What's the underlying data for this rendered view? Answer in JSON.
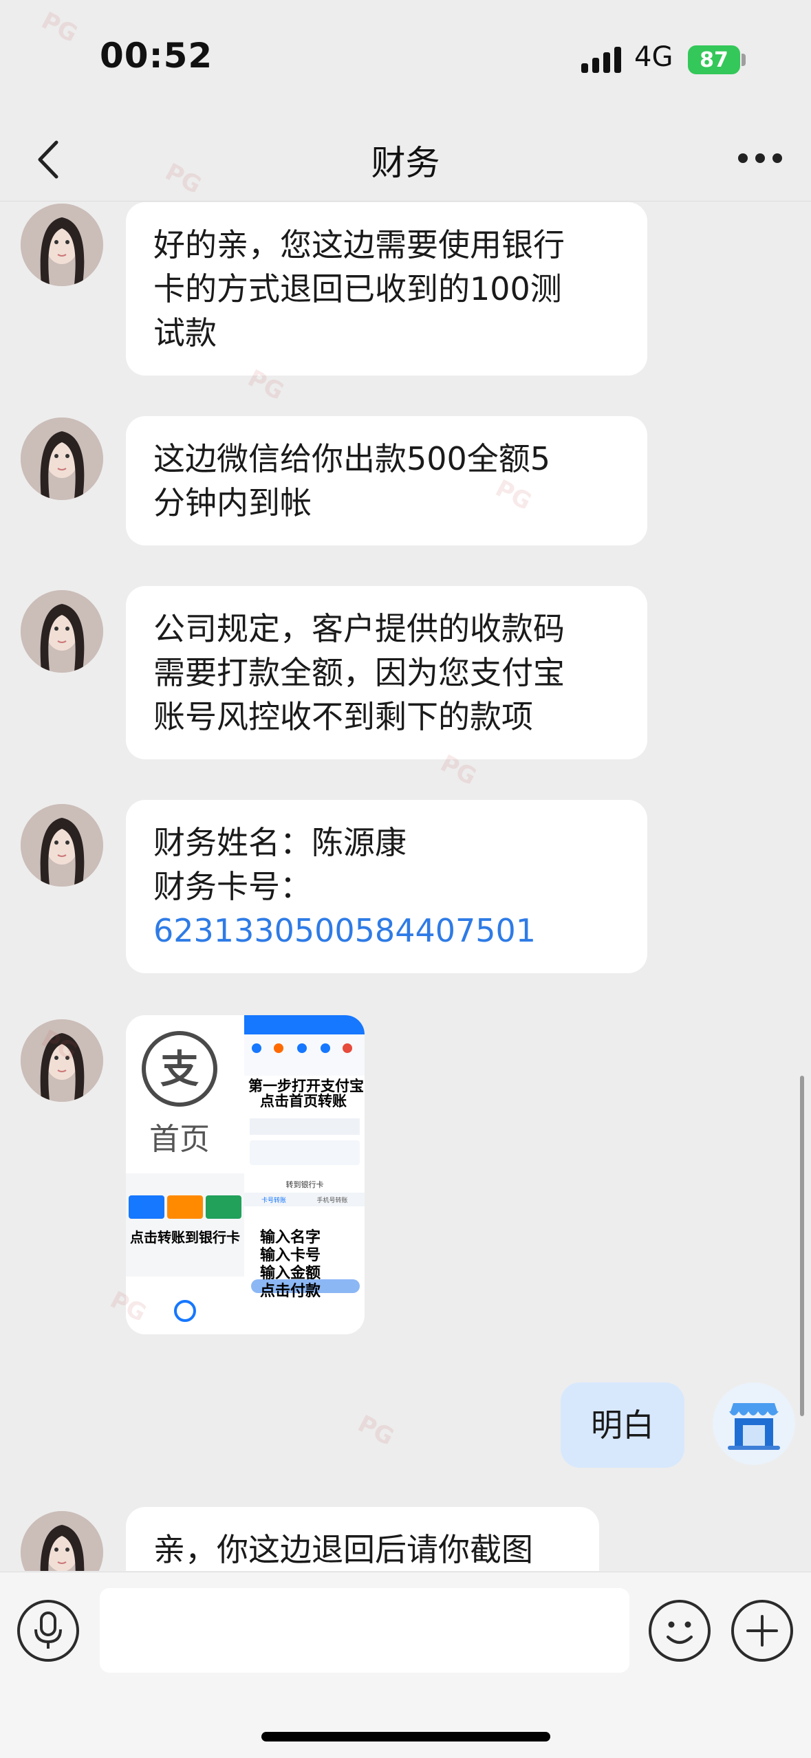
{
  "status_bar": {
    "time": "00:52",
    "network": "4G",
    "battery": "87"
  },
  "nav": {
    "title": "财务"
  },
  "messages": [
    {
      "type": "text",
      "lines": [
        "好的亲，您这边需要使用银行",
        "卡的方式退回已收到的100测",
        "试款"
      ]
    },
    {
      "type": "text",
      "lines": [
        "这边微信给你出款500全额5",
        "分钟内到帐"
      ]
    },
    {
      "type": "text",
      "lines": [
        "公司规定，客户提供的收款码",
        "需要打款全额，因为您支付宝",
        "账号风控收不到剩下的款项"
      ]
    },
    {
      "type": "card",
      "name_line": "财务姓名：陈源康",
      "card_label": "财务卡号：",
      "card_number": "6231330500584407501"
    },
    {
      "type": "image",
      "alipay_logo_char": "支",
      "home_label": "首页",
      "step1_line1": "第一步打开支付宝",
      "step1_line2": "点击首页转账",
      "step2": "点击转账到银行卡",
      "transfer_title": "转到银行卡",
      "tab_card": "卡号转账",
      "tab_phone": "手机号转账",
      "steps": [
        "输入名字",
        "输入卡号",
        "输入金额",
        "点击付款"
      ]
    },
    {
      "type": "outgoing",
      "text": "明白"
    },
    {
      "type": "text",
      "lines": [
        "亲，你这边退回后请你截图"
      ]
    }
  ],
  "watermark": "PG",
  "colors": {
    "background": "#ededed",
    "incoming_bubble": "#ffffff",
    "outgoing_bubble": "#d7e8fd",
    "link": "#2e7be6",
    "battery": "#34c759"
  }
}
